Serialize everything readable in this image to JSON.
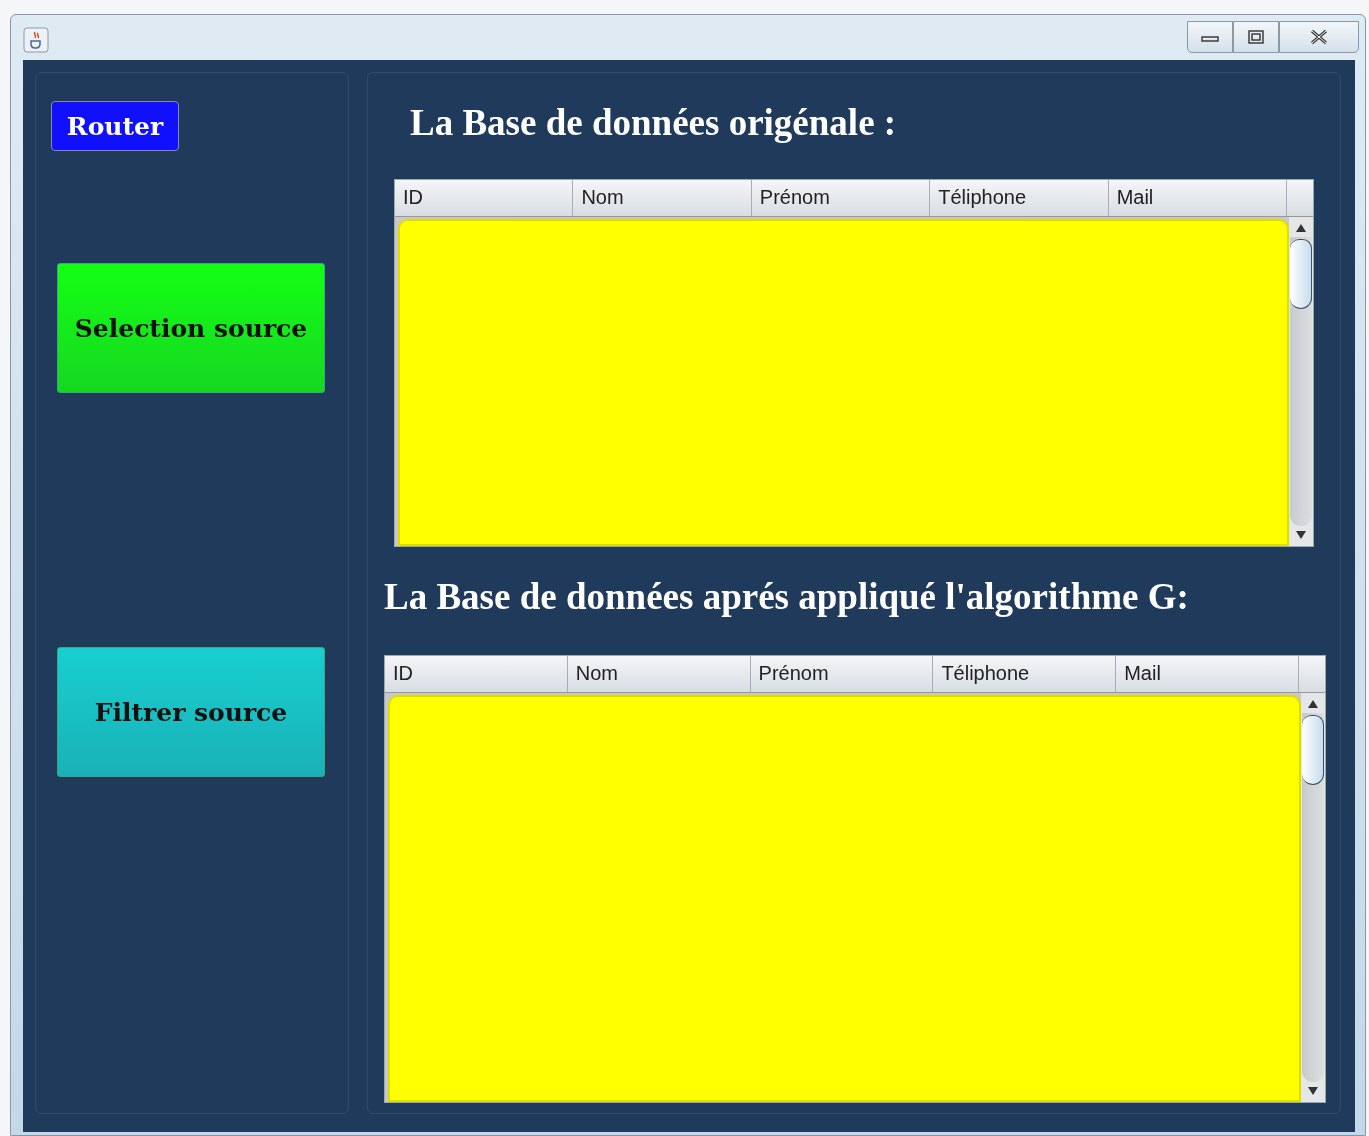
{
  "sidebar": {
    "buttons": [
      {
        "label": "Router",
        "kind": "small",
        "color": "#1010ff"
      },
      {
        "label": "Selection source",
        "kind": "large",
        "color": "#14ff14"
      },
      {
        "label": "Filtrer source",
        "kind": "large",
        "color": "#18cfcf"
      }
    ]
  },
  "tables": [
    {
      "title": "La Base de données origénale :",
      "columns": [
        "ID",
        "Nom",
        "Prénom",
        "Téliphone",
        "Mail"
      ]
    },
    {
      "title": "La Base de données aprés appliqué l'algorithme G:",
      "columns": [
        "ID",
        "Nom",
        "Prénom",
        "Téliphone",
        "Mail"
      ]
    }
  ]
}
